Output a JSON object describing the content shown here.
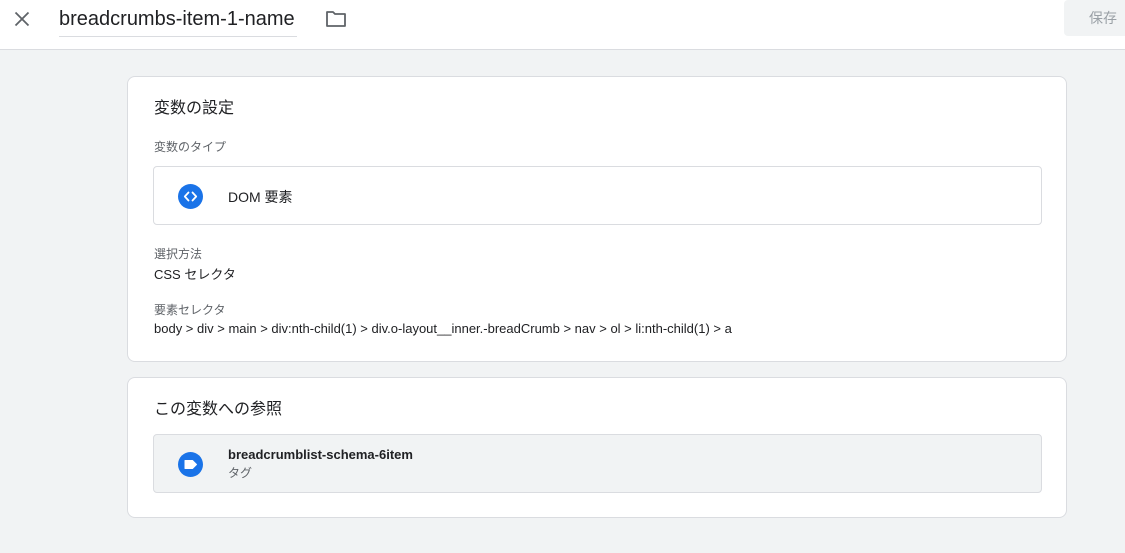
{
  "header": {
    "close_icon": "close-icon",
    "title": "breadcrumbs-item-1-name",
    "folder_icon": "folder-icon",
    "save_label": "保存"
  },
  "config_card": {
    "title": "変数の設定",
    "type_label": "変数のタイプ",
    "type": {
      "icon": "code-brackets-icon",
      "name": "DOM 要素"
    },
    "selection_method_label": "選択方法",
    "selection_method_value": "CSS セレクタ",
    "selector_label": "要素セレクタ",
    "selector_value": "body > div > main > div:nth-child(1) > div.o-layout__inner.-breadCrumb > nav > ol > li:nth-child(1) > a"
  },
  "references_card": {
    "title": "この変数への参照",
    "items": [
      {
        "icon": "tag-icon",
        "name": "breadcrumblist-schema-6item",
        "type": "タグ"
      }
    ]
  },
  "colors": {
    "accent": "#1a73e8",
    "page_background": "#f1f3f4",
    "border": "#dadce0"
  }
}
